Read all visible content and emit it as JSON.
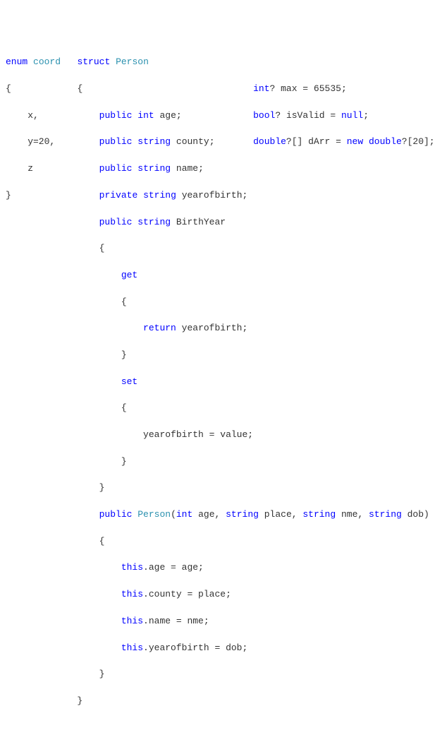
{
  "col1": {
    "l1a": "enum",
    "l1b": "coord",
    "l2": "{",
    "l3": "    x,",
    "l4": "    y=20,",
    "l5": "    z",
    "l6": "}"
  },
  "col2": {
    "l1a": "struct",
    "l1b": "Person",
    "l2": "{",
    "l3a": "public",
    "l3b": "int",
    "l3c": "age;",
    "l4a": "public",
    "l4b": "string",
    "l4c": "county;",
    "l5a": "public",
    "l5b": "string",
    "l5c": "name;",
    "l6a": "private",
    "l6b": "string",
    "l6c": "yearofbirth;",
    "l7a": "public",
    "l7b": "string",
    "l7c": "BirthYear",
    "l8": "{",
    "l9": "get",
    "l10": "{",
    "l11a": "return",
    "l11b": "yearofbirth;",
    "l12": "}",
    "l13": "set",
    "l14": "{",
    "l15": "yearofbirth = value;",
    "l16": "}",
    "l17": "}",
    "l18a": "public",
    "l18b": "Person",
    "l18c": "(",
    "l18d": "int",
    "l18e": "age, ",
    "l18f": "string",
    "l18g": "place, ",
    "l18h": "string",
    "l18i": "nme, ",
    "l18j": "string",
    "l18k": "dob)",
    "l19": "{",
    "l20a": "this",
    "l20b": ".age = age;",
    "l21a": "this",
    "l21b": ".county = place;",
    "l22a": "this",
    "l22b": ".name = nme;",
    "l23a": "this",
    "l23b": ".yearofbirth = dob;",
    "l24": "}",
    "l25": "}"
  },
  "col3": {
    "l1a": "int",
    "l1b": "? max = ",
    "l1c": "65535",
    "l1d": ";",
    "l2a": "bool",
    "l2b": "? isValid = ",
    "l2c": "null",
    "l2d": ";",
    "l3a": "double",
    "l3b": "?[] dArr = ",
    "l3c": "new",
    "l3d": " ",
    "l3e": "double",
    "l3f": "?[",
    "l3g": "20",
    "l3h": "];"
  }
}
